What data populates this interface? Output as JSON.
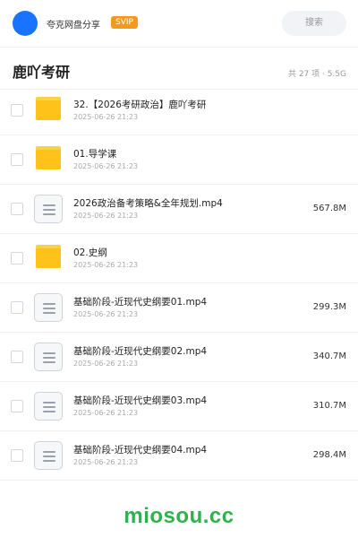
{
  "header": {
    "brand": "夸克网盘分享",
    "badge": "SVIP",
    "search_label": "搜索"
  },
  "folder": {
    "title": "鹿吖考研",
    "meta": "共 27 项 · 5.5G"
  },
  "items": [
    {
      "type": "folder",
      "name": "32.【2026考研政治】鹿吖考研",
      "date": "2025-06-26 21:23",
      "size": ""
    },
    {
      "type": "folder",
      "name": "01.导学课",
      "date": "2025-06-26 21:23",
      "size": ""
    },
    {
      "type": "file",
      "name": "2026政治备考策略&全年规划.mp4",
      "date": "2025-06-26 21:23",
      "size": "567.8M"
    },
    {
      "type": "folder",
      "name": "02.史纲",
      "date": "2025-06-26 21:23",
      "size": ""
    },
    {
      "type": "file",
      "name": "基础阶段-近现代史纲要01.mp4",
      "date": "2025-06-26 21:23",
      "size": "299.3M"
    },
    {
      "type": "file",
      "name": "基础阶段-近现代史纲要02.mp4",
      "date": "2025-06-26 21:23",
      "size": "340.7M"
    },
    {
      "type": "file",
      "name": "基础阶段-近现代史纲要03.mp4",
      "date": "2025-06-26 21:23",
      "size": "310.7M"
    },
    {
      "type": "file",
      "name": "基础阶段-近现代史纲要04.mp4",
      "date": "2025-06-26 21:23",
      "size": "298.4M"
    }
  ],
  "watermark": "miosou.cc",
  "colors": {
    "avatar": "#1a73ff",
    "badge": "#f39a1e",
    "folder": "#ffc21a",
    "watermark": "#2fb14d"
  }
}
